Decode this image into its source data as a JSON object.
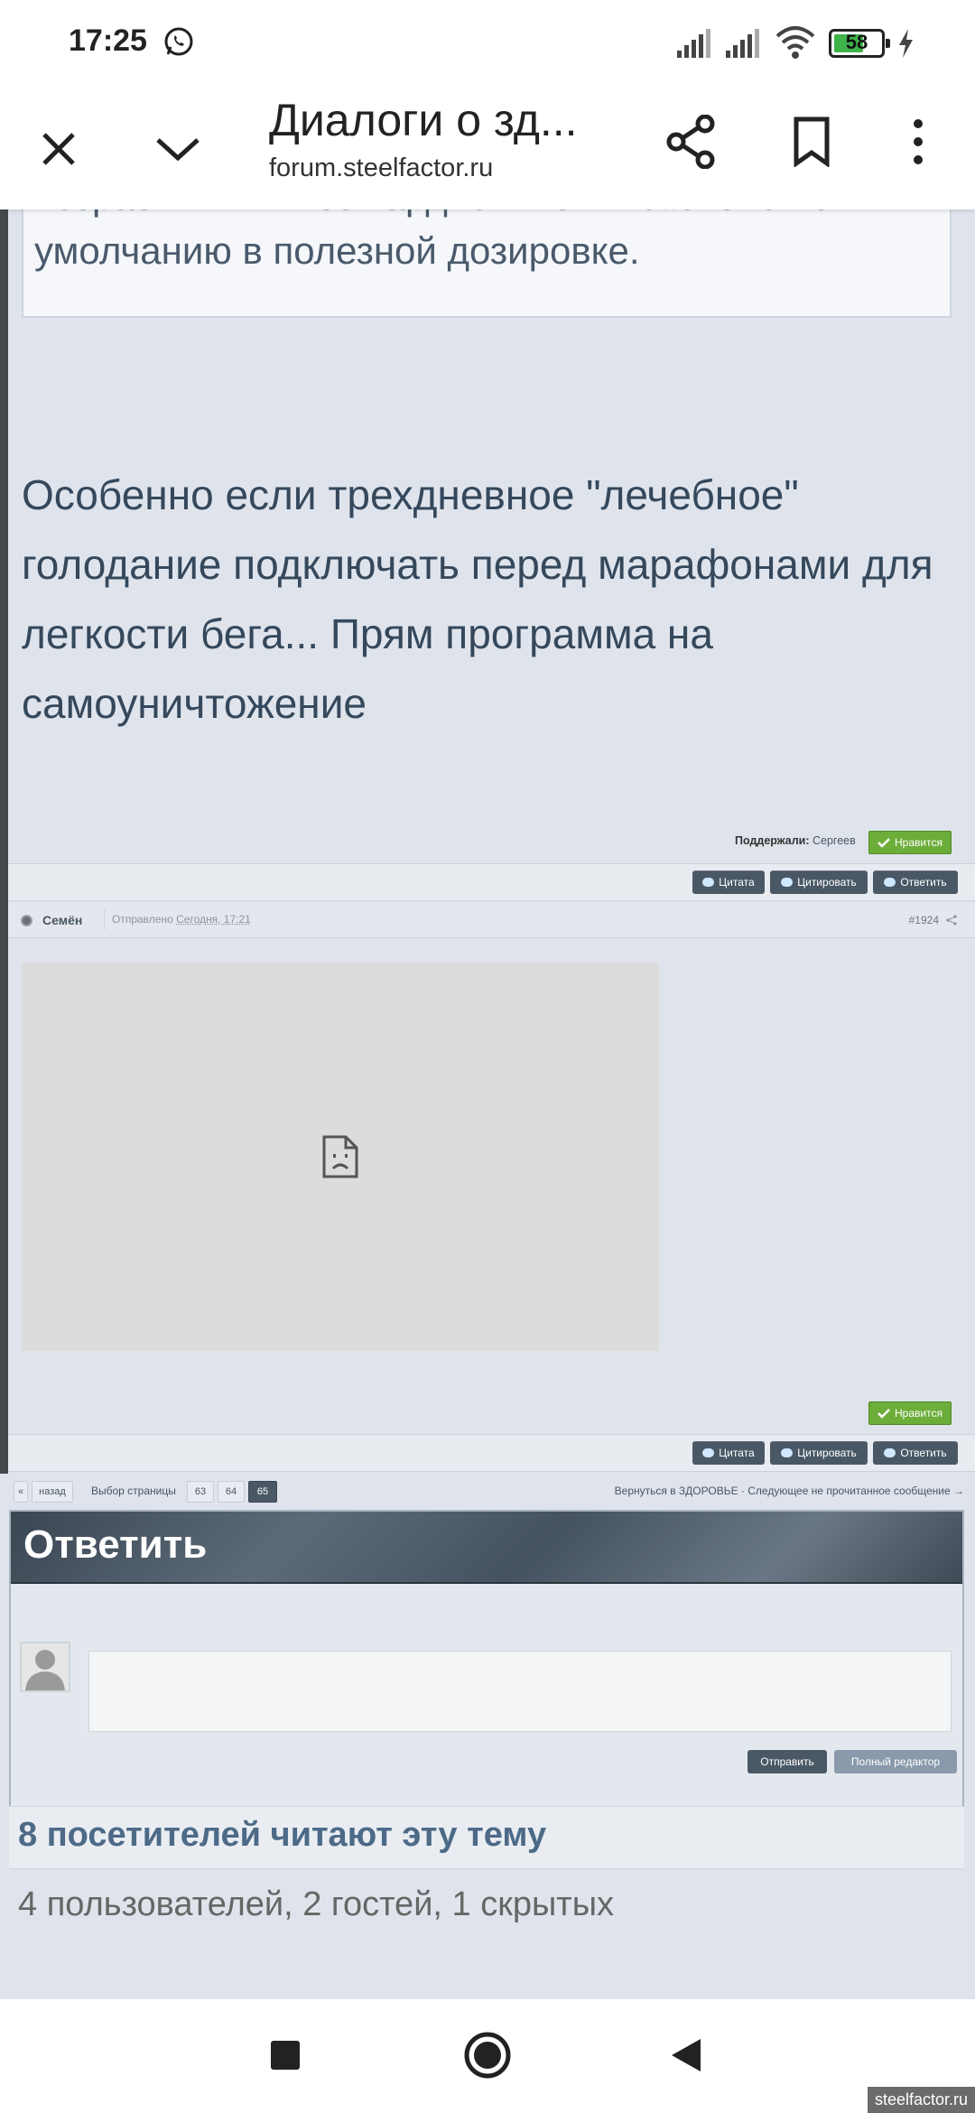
{
  "status_bar": {
    "time": "17:25",
    "battery_level": "58"
  },
  "browser": {
    "title": "Диалоги о зд...",
    "url": "forum.steelfactor.ru"
  },
  "post1": {
    "quote_text_partial": "возрастных. И все кардио в нем включено по",
    "quote_text": "умолчанию в полезной дозировке.",
    "body": "Особенно если трехдневное \"лечебное\" голодание подключать перед марафонами для легкости бега... Прям программа на самоуничтожение",
    "supported_label": "Поддержали:",
    "supported_users": "Сергеев",
    "like_label": "Нравится",
    "actions": [
      "Цитата",
      "Цитировать",
      "Ответить"
    ]
  },
  "post2": {
    "author": "Семён",
    "posted_label": "Отправлено",
    "posted_time": "Сегодня, 17:21",
    "post_number": "#1924",
    "like_label": "Нравится",
    "actions": [
      "Цитата",
      "Цитировать",
      "Ответить"
    ]
  },
  "pagination": {
    "prev_arrow": "«",
    "back_label": "назад",
    "select_label": "Выбор страницы",
    "pages": [
      "63",
      "64",
      "65"
    ],
    "current_page": "65",
    "right_links": "Вернуться в ЗДОРОВЬЕ · Следующее не прочитанное сообщение →"
  },
  "reply": {
    "title": "Ответить",
    "send_label": "Отправить",
    "full_editor_label": "Полный редактор"
  },
  "visitors": {
    "title": "8 посетителей читают эту тему",
    "subtitle": "4 пользователей, 2 гостей, 1 скрытых"
  },
  "watermark": "steelfactor.ru",
  "colors": {
    "like_green": "#6dad3a",
    "action_button": "#4a5866",
    "page_bg": "#dfe4ec"
  }
}
